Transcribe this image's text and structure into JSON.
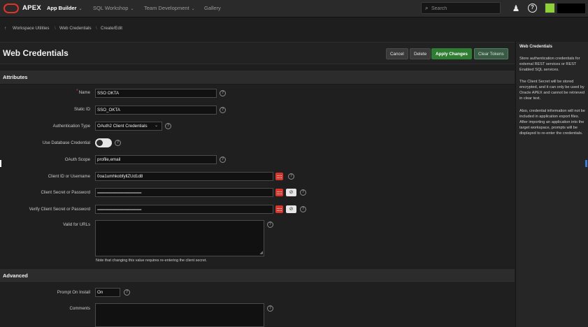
{
  "topbar": {
    "brand": "APEX",
    "nav": [
      {
        "label": "App Builder",
        "chevron": "⌄",
        "active": true
      },
      {
        "label": "SQL Workshop",
        "chevron": "⌄",
        "active": false
      },
      {
        "label": "Team Development",
        "chevron": "⌄",
        "active": false
      },
      {
        "label": "Gallery",
        "chevron": "",
        "active": false
      }
    ],
    "search_placeholder": "Search",
    "icons": {
      "search": "search-icon",
      "user": "person-plus-icon",
      "help": "?"
    },
    "colors": {
      "brand": "#e0342b",
      "avatar": "#8fd13a"
    }
  },
  "breadcrumb": {
    "up": "↑",
    "items": [
      "Workspace Utilities",
      "Web Credentials",
      "Create/Edit"
    ],
    "separator": "\\"
  },
  "header": {
    "title": "Web Credentials",
    "buttons": {
      "cancel": "Cancel",
      "delete": "Delete",
      "apply": "Apply Changes",
      "clear": "Clear Tokens"
    }
  },
  "attributes": {
    "title": "Attributes",
    "name": {
      "label": "Name",
      "value": "SSO OKTA",
      "required": "*"
    },
    "static_id": {
      "label": "Static ID",
      "value": "SSO_OKTA"
    },
    "auth_type": {
      "label": "Authentication Type",
      "value": "OAuth2 Client Credentials"
    },
    "use_db_cred": {
      "label": "Use Database Credential",
      "value": "off"
    },
    "oauth_scope": {
      "label": "OAuth Scope",
      "value": "profile,email"
    },
    "client_id": {
      "label": "Client ID or Username",
      "value": "0oa1umhkobfyllZUd1d8"
    },
    "client_secret": {
      "label": "Client Secret or Password",
      "value": "••••••••••••••••••••••••••••••••••••••••••••••••••••••••••••••••••••••"
    },
    "verify_secret": {
      "label": "Verify Client Secret or Password",
      "value": "••••••••••••••••••••••••••••••••••••••••••••••••••••••••••••••••••••••"
    },
    "valid_urls": {
      "label": "Valid for URLs",
      "value": ""
    },
    "note": "Note that changing this value requires re-entering the client secret."
  },
  "advanced": {
    "title": "Advanced",
    "prompt_on_install": {
      "label": "Prompt On Install",
      "value": "On"
    },
    "comments": {
      "label": "Comments",
      "value": ""
    }
  },
  "help_panel": {
    "title": "Web Credentials",
    "paragraphs": [
      "Store authentication credentials for external REST services or REST Enabled SQL services.",
      "The Client Secret will be stored encrypted, and it can only be used by Oracle APEX and cannot be retrieved in clear text.",
      "Also, credential information will not be included in application export files. After importing an application into the target workspace, prompts will be displayed to re-enter the credentials."
    ]
  }
}
